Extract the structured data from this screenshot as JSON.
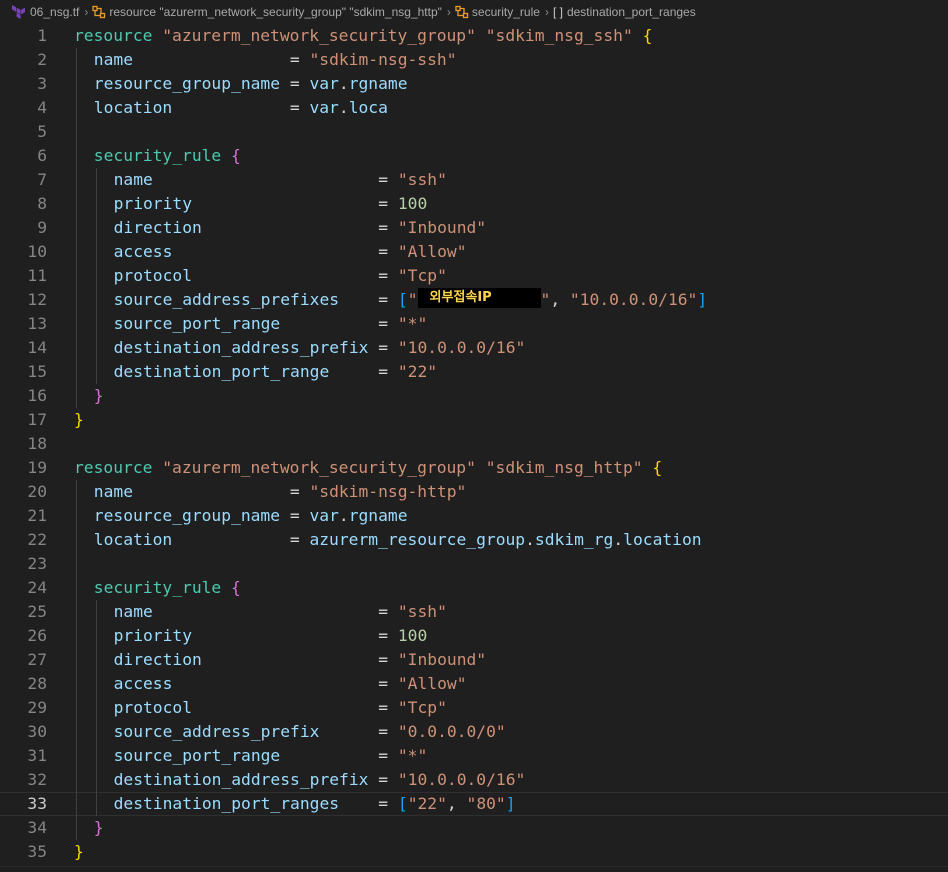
{
  "breadcrumb": [
    {
      "label": "06_nsg.tf",
      "icon": "terraform-file-icon"
    },
    {
      "label": "resource \"azurerm_network_security_group\" \"sdkim_nsg_http\"",
      "icon": "symbol-class-icon"
    },
    {
      "label": "security_rule",
      "icon": "symbol-class-icon"
    },
    {
      "label": "destination_port_ranges",
      "icon": "symbol-array-icon"
    }
  ],
  "editor": {
    "current_line": 33,
    "redaction_text": "외부접속IP",
    "colors": {
      "background": "#1f1f1f",
      "keyword": "#4ec9b0",
      "string": "#ce9178",
      "attribute": "#9cdcfe",
      "number": "#b5cea8",
      "bracket1": "#ffd700",
      "bracket2": "#da70d6",
      "bracket3": "#179fff"
    },
    "lines": [
      {
        "n": "1",
        "i": 0,
        "t": [
          [
            "kw",
            "resource"
          ],
          [
            "op",
            " "
          ],
          [
            "str",
            "\"azurerm_network_security_group\""
          ],
          [
            "op",
            " "
          ],
          [
            "str",
            "\"sdkim_nsg_ssh\""
          ],
          [
            "op",
            " "
          ],
          [
            "b1",
            "{"
          ]
        ]
      },
      {
        "n": "2",
        "i": 1,
        "t": [
          [
            "attr",
            "name"
          ],
          [
            "op",
            "                = "
          ],
          [
            "str",
            "\"sdkim-nsg-ssh\""
          ]
        ]
      },
      {
        "n": "3",
        "i": 1,
        "t": [
          [
            "attr",
            "resource_group_name"
          ],
          [
            "op",
            " = "
          ],
          [
            "attr",
            "var"
          ],
          [
            "op",
            "."
          ],
          [
            "attr",
            "rgname"
          ]
        ]
      },
      {
        "n": "4",
        "i": 1,
        "t": [
          [
            "attr",
            "location"
          ],
          [
            "op",
            "            = "
          ],
          [
            "attr",
            "var"
          ],
          [
            "op",
            "."
          ],
          [
            "attr",
            "loca"
          ]
        ]
      },
      {
        "n": "5",
        "i": 1,
        "t": []
      },
      {
        "n": "6",
        "i": 1,
        "t": [
          [
            "kw",
            "security_rule"
          ],
          [
            "op",
            " "
          ],
          [
            "b2",
            "{"
          ]
        ]
      },
      {
        "n": "7",
        "i": 2,
        "t": [
          [
            "attr",
            "name"
          ],
          [
            "op",
            "                       = "
          ],
          [
            "str",
            "\"ssh\""
          ]
        ]
      },
      {
        "n": "8",
        "i": 2,
        "t": [
          [
            "attr",
            "priority"
          ],
          [
            "op",
            "                   = "
          ],
          [
            "num",
            "100"
          ]
        ]
      },
      {
        "n": "9",
        "i": 2,
        "t": [
          [
            "attr",
            "direction"
          ],
          [
            "op",
            "                  = "
          ],
          [
            "str",
            "\"Inbound\""
          ]
        ]
      },
      {
        "n": "10",
        "i": 2,
        "t": [
          [
            "attr",
            "access"
          ],
          [
            "op",
            "                     = "
          ],
          [
            "str",
            "\"Allow\""
          ]
        ]
      },
      {
        "n": "11",
        "i": 2,
        "t": [
          [
            "attr",
            "protocol"
          ],
          [
            "op",
            "                   = "
          ],
          [
            "str",
            "\"Tcp\""
          ]
        ]
      },
      {
        "n": "12",
        "i": 2,
        "t": [
          [
            "attr",
            "source_address_prefixes"
          ],
          [
            "op",
            "    = "
          ],
          [
            "b3",
            "["
          ],
          [
            "str",
            "\""
          ],
          [
            "redact",
            ""
          ],
          [
            "str",
            "\""
          ],
          [
            "op",
            ", "
          ],
          [
            "str",
            "\"10.0.0.0/16\""
          ],
          [
            "b3",
            "]"
          ]
        ]
      },
      {
        "n": "13",
        "i": 2,
        "t": [
          [
            "attr",
            "source_port_range"
          ],
          [
            "op",
            "          = "
          ],
          [
            "str",
            "\"*\""
          ]
        ]
      },
      {
        "n": "14",
        "i": 2,
        "t": [
          [
            "attr",
            "destination_address_prefix"
          ],
          [
            "op",
            " = "
          ],
          [
            "str",
            "\"10.0.0.0/16\""
          ]
        ]
      },
      {
        "n": "15",
        "i": 2,
        "t": [
          [
            "attr",
            "destination_port_range"
          ],
          [
            "op",
            "     = "
          ],
          [
            "str",
            "\"22\""
          ]
        ]
      },
      {
        "n": "16",
        "i": 1,
        "t": [
          [
            "b2",
            "}"
          ]
        ]
      },
      {
        "n": "17",
        "i": 0,
        "t": [
          [
            "b1",
            "}"
          ]
        ]
      },
      {
        "n": "18",
        "i": 0,
        "t": []
      },
      {
        "n": "19",
        "i": 0,
        "t": [
          [
            "kw",
            "resource"
          ],
          [
            "op",
            " "
          ],
          [
            "str",
            "\"azurerm_network_security_group\""
          ],
          [
            "op",
            " "
          ],
          [
            "str",
            "\"sdkim_nsg_http\""
          ],
          [
            "op",
            " "
          ],
          [
            "b1",
            "{"
          ]
        ]
      },
      {
        "n": "20",
        "i": 1,
        "t": [
          [
            "attr",
            "name"
          ],
          [
            "op",
            "                = "
          ],
          [
            "str",
            "\"sdkim-nsg-http\""
          ]
        ]
      },
      {
        "n": "21",
        "i": 1,
        "t": [
          [
            "attr",
            "resource_group_name"
          ],
          [
            "op",
            " = "
          ],
          [
            "attr",
            "var"
          ],
          [
            "op",
            "."
          ],
          [
            "attr",
            "rgname"
          ]
        ]
      },
      {
        "n": "22",
        "i": 1,
        "t": [
          [
            "attr",
            "location"
          ],
          [
            "op",
            "            = "
          ],
          [
            "attr",
            "azurerm_resource_group"
          ],
          [
            "op",
            "."
          ],
          [
            "attr",
            "sdkim_rg"
          ],
          [
            "op",
            "."
          ],
          [
            "attr",
            "location"
          ]
        ]
      },
      {
        "n": "23",
        "i": 1,
        "t": []
      },
      {
        "n": "24",
        "i": 1,
        "t": [
          [
            "kw",
            "security_rule"
          ],
          [
            "op",
            " "
          ],
          [
            "b2",
            "{"
          ]
        ]
      },
      {
        "n": "25",
        "i": 2,
        "t": [
          [
            "attr",
            "name"
          ],
          [
            "op",
            "                       = "
          ],
          [
            "str",
            "\"ssh\""
          ]
        ]
      },
      {
        "n": "26",
        "i": 2,
        "t": [
          [
            "attr",
            "priority"
          ],
          [
            "op",
            "                   = "
          ],
          [
            "num",
            "100"
          ]
        ]
      },
      {
        "n": "27",
        "i": 2,
        "t": [
          [
            "attr",
            "direction"
          ],
          [
            "op",
            "                  = "
          ],
          [
            "str",
            "\"Inbound\""
          ]
        ]
      },
      {
        "n": "28",
        "i": 2,
        "t": [
          [
            "attr",
            "access"
          ],
          [
            "op",
            "                     = "
          ],
          [
            "str",
            "\"Allow\""
          ]
        ]
      },
      {
        "n": "29",
        "i": 2,
        "t": [
          [
            "attr",
            "protocol"
          ],
          [
            "op",
            "                   = "
          ],
          [
            "str",
            "\"Tcp\""
          ]
        ]
      },
      {
        "n": "30",
        "i": 2,
        "t": [
          [
            "attr",
            "source_address_prefix"
          ],
          [
            "op",
            "      = "
          ],
          [
            "str",
            "\"0.0.0.0/0\""
          ]
        ]
      },
      {
        "n": "31",
        "i": 2,
        "t": [
          [
            "attr",
            "source_port_range"
          ],
          [
            "op",
            "          = "
          ],
          [
            "str",
            "\"*\""
          ]
        ]
      },
      {
        "n": "32",
        "i": 2,
        "t": [
          [
            "attr",
            "destination_address_prefix"
          ],
          [
            "op",
            " = "
          ],
          [
            "str",
            "\"10.0.0.0/16\""
          ]
        ]
      },
      {
        "n": "33",
        "i": 2,
        "t": [
          [
            "attr",
            "destination_port_ranges"
          ],
          [
            "op",
            "    = "
          ],
          [
            "b3",
            "["
          ],
          [
            "str",
            "\"22\""
          ],
          [
            "op",
            ", "
          ],
          [
            "str",
            "\"80\""
          ],
          [
            "b3",
            "]"
          ]
        ]
      },
      {
        "n": "34",
        "i": 1,
        "t": [
          [
            "b2",
            "}"
          ]
        ]
      },
      {
        "n": "35",
        "i": 0,
        "t": [
          [
            "b1",
            "}"
          ]
        ]
      }
    ]
  }
}
